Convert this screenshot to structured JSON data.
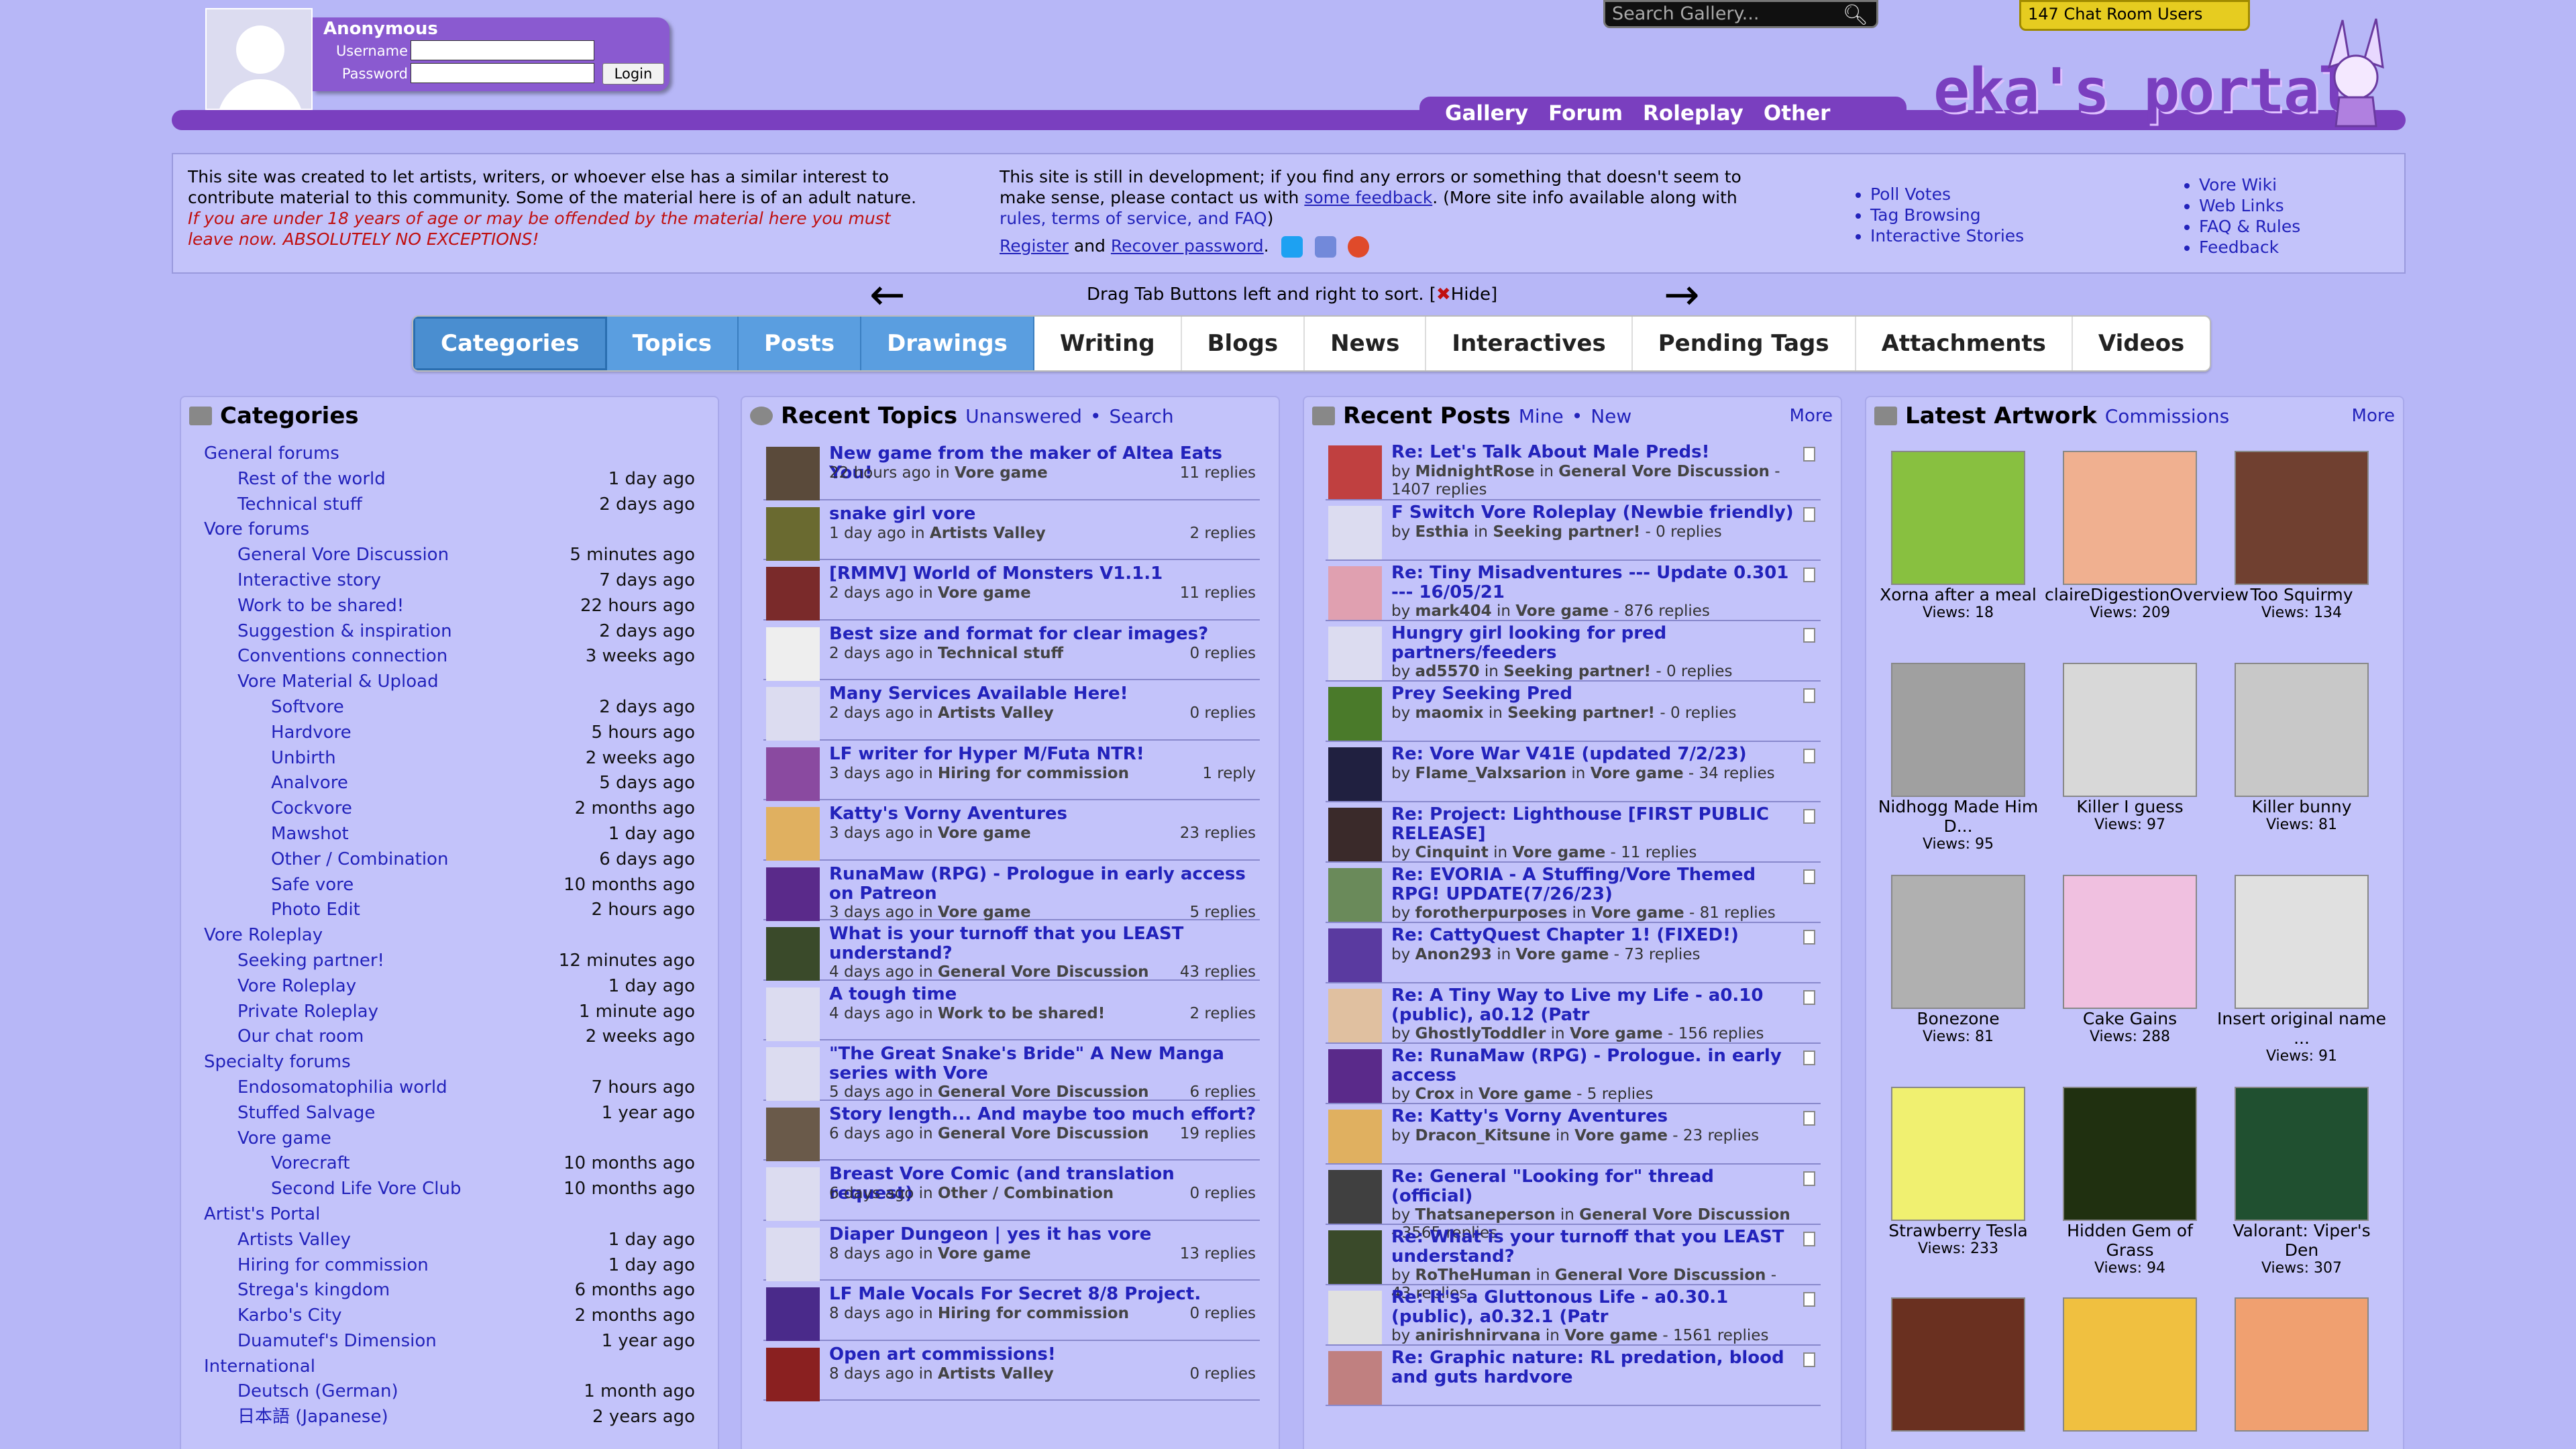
{
  "header": {
    "user": "Anonymous",
    "username_label": "Username",
    "password_label": "Password",
    "login_button": "Login",
    "search_placeholder": "Search Gallery...",
    "chat_users": "147 Chat Room Users",
    "logo_text": "eka's portal",
    "nav": [
      "Gallery",
      "Forum",
      "Roleplay",
      "Other"
    ]
  },
  "info": {
    "intro": "This site was created to let artists, writers, or whoever else has a similar interest to contribute material to this community. Some of the material here is of an adult nature.",
    "warning": "If you are under 18 years of age or may be offended by the material here you must leave now. ABSOLUTELY NO EXCEPTIONS!",
    "dev_text_1": "This site is still in development; if you find any errors or something that doesn't seem to make sense, please contact us with",
    "dev_link_feedback": "some feedback",
    "dev_text_2": ". (More site info available along with",
    "dev_link_rules": "rules, terms of service, and FAQ",
    "dev_text_3": ")",
    "register": "Register",
    "and": "and",
    "recover": "Recover password",
    "links_a": [
      "Poll Votes",
      "Tag Browsing",
      "Interactive Stories"
    ],
    "links_b": [
      "Vore Wiki",
      "Web Links",
      "FAQ & Rules",
      "Feedback"
    ]
  },
  "drag": {
    "text": "Drag Tab Buttons left and right to sort. [",
    "hide": "Hide]",
    "left_arrow": "←",
    "right_arrow": "→"
  },
  "tabs": [
    "Categories",
    "Topics",
    "Posts",
    "Drawings",
    "Writing",
    "Blogs",
    "News",
    "Interactives",
    "Pending Tags",
    "Attachments",
    "Videos"
  ],
  "categories": {
    "title": "Categories",
    "rows": [
      {
        "name": "General forums",
        "time": "",
        "indent": 0
      },
      {
        "name": "Rest of the world",
        "time": "1 day ago",
        "indent": 1
      },
      {
        "name": "Technical stuff",
        "time": "2 days ago",
        "indent": 1
      },
      {
        "name": "Vore forums",
        "time": "",
        "indent": 0
      },
      {
        "name": "General Vore Discussion",
        "time": "5 minutes ago",
        "indent": 1
      },
      {
        "name": "Interactive story",
        "time": "7 days ago",
        "indent": 1
      },
      {
        "name": "Work to be shared!",
        "time": "22 hours ago",
        "indent": 1
      },
      {
        "name": "Suggestion & inspiration",
        "time": "2 days ago",
        "indent": 1
      },
      {
        "name": "Conventions connection",
        "time": "3 weeks ago",
        "indent": 1
      },
      {
        "name": "Vore Material & Upload",
        "time": "",
        "indent": 1
      },
      {
        "name": "Softvore",
        "time": "2 days ago",
        "indent": 2
      },
      {
        "name": "Hardvore",
        "time": "5 hours ago",
        "indent": 2
      },
      {
        "name": "Unbirth",
        "time": "2 weeks ago",
        "indent": 2
      },
      {
        "name": "Analvore",
        "time": "5 days ago",
        "indent": 2
      },
      {
        "name": "Cockvore",
        "time": "2 months ago",
        "indent": 2
      },
      {
        "name": "Mawshot",
        "time": "1 day ago",
        "indent": 2
      },
      {
        "name": "Other / Combination",
        "time": "6 days ago",
        "indent": 2
      },
      {
        "name": "Safe vore",
        "time": "10 months ago",
        "indent": 2
      },
      {
        "name": "Photo Edit",
        "time": "2 hours ago",
        "indent": 2
      },
      {
        "name": "Vore Roleplay",
        "time": "",
        "indent": 0
      },
      {
        "name": "Seeking partner!",
        "time": "12 minutes ago",
        "indent": 1
      },
      {
        "name": "Vore Roleplay",
        "time": "1 day ago",
        "indent": 1
      },
      {
        "name": "Private Roleplay",
        "time": "1 minute ago",
        "indent": 1
      },
      {
        "name": "Our chat room",
        "time": "2 weeks ago",
        "indent": 1
      },
      {
        "name": "Specialty forums",
        "time": "",
        "indent": 0
      },
      {
        "name": "Endosomatophilia world",
        "time": "7 hours ago",
        "indent": 1
      },
      {
        "name": "Stuffed Salvage",
        "time": "1 year ago",
        "indent": 1
      },
      {
        "name": "Vore game",
        "time": "",
        "indent": 1
      },
      {
        "name": "Vorecraft",
        "time": "10 months ago",
        "indent": 2
      },
      {
        "name": "Second Life Vore Club",
        "time": "10 months ago",
        "indent": 2
      },
      {
        "name": "Artist's Portal",
        "time": "",
        "indent": 0
      },
      {
        "name": "Artists Valley",
        "time": "1 day ago",
        "indent": 1
      },
      {
        "name": "Hiring for commission",
        "time": "1 day ago",
        "indent": 1
      },
      {
        "name": "Strega's kingdom",
        "time": "6 months ago",
        "indent": 1
      },
      {
        "name": "Karbo's City",
        "time": "2 months ago",
        "indent": 1
      },
      {
        "name": "Duamutef's Dimension",
        "time": "1 year ago",
        "indent": 1
      },
      {
        "name": "International",
        "time": "",
        "indent": 0
      },
      {
        "name": "Deutsch (German)",
        "time": "1 month ago",
        "indent": 1
      },
      {
        "name": "日本語 (Japanese)",
        "time": "2 years ago",
        "indent": 1
      }
    ]
  },
  "topics": {
    "title": "Recent Topics",
    "unanswered": "Unanswered",
    "sep": "•",
    "search": "Search",
    "items": [
      {
        "title": "New game from the maker of Altea Eats You!",
        "time": "22 hours ago in",
        "cat": "Vore game",
        "replies": "11 replies",
        "color": "#5a4a3a"
      },
      {
        "title": "snake girl vore",
        "time": "1 day ago in",
        "cat": "Artists Valley",
        "replies": "2 replies",
        "color": "#6a6a30"
      },
      {
        "title": "[RMMV] World of Monsters V1.1.1",
        "time": "2 days ago in",
        "cat": "Vore game",
        "replies": "11 replies",
        "color": "#7a2a2a"
      },
      {
        "title": "Best size and format for clear images?",
        "time": "2 days ago in",
        "cat": "Technical stuff",
        "replies": "0 replies",
        "color": "#eeeeee"
      },
      {
        "title": "Many Services Available Here!",
        "time": "2 days ago in",
        "cat": "Artists Valley",
        "replies": "0 replies",
        "color": "#dcdcf0"
      },
      {
        "title": "LF writer for Hyper M/Futa NTR!",
        "time": "3 days ago in",
        "cat": "Hiring for commission",
        "replies": "1 reply",
        "color": "#8a4aa0"
      },
      {
        "title": "Katty's Vorny Aventures",
        "time": "3 days ago in",
        "cat": "Vore game",
        "replies": "23 replies",
        "color": "#e0b060"
      },
      {
        "title": "RunaMaw (RPG) - Prologue in early access on Patreon",
        "time": "3 days ago in",
        "cat": "Vore game",
        "replies": "5 replies",
        "color": "#5a2a8a"
      },
      {
        "title": "What is your turnoff that you LEAST understand?",
        "time": "4 days ago in",
        "cat": "General Vore Discussion",
        "replies": "43 replies",
        "color": "#3a4a2a"
      },
      {
        "title": "A tough time",
        "time": "4 days ago in",
        "cat": "Work to be shared!",
        "replies": "2 replies",
        "color": "#dcdcf0"
      },
      {
        "title": "\"The Great Snake's Bride\" A New Manga series with Vore",
        "time": "5 days ago in",
        "cat": "General Vore Discussion",
        "replies": "6 replies",
        "color": "#dcdcf0"
      },
      {
        "title": "Story length... And maybe too much effort?",
        "time": "6 days ago in",
        "cat": "General Vore Discussion",
        "replies": "19 replies",
        "color": "#6a5a4a"
      },
      {
        "title": "Breast Vore Comic (and translation request)",
        "time": "6 days ago in",
        "cat": "Other / Combination",
        "replies": "0 replies",
        "color": "#dcdcf0"
      },
      {
        "title": "Diaper Dungeon | yes it has vore",
        "time": "8 days ago in",
        "cat": "Vore game",
        "replies": "13 replies",
        "color": "#dcdcf0"
      },
      {
        "title": "LF Male Vocals For Secret 8/8 Project.",
        "time": "8 days ago in",
        "cat": "Hiring for commission",
        "replies": "0 replies",
        "color": "#4a2a8a"
      },
      {
        "title": "Open art commissions!",
        "time": "8 days ago in",
        "cat": "Artists Valley",
        "replies": "0 replies",
        "color": "#8a2020"
      }
    ]
  },
  "posts": {
    "title": "Recent Posts",
    "mine": "Mine",
    "sep": "•",
    "new": "New",
    "more": "More",
    "items": [
      {
        "title": "Re: Let's Talk About Male Preds!",
        "by": "MidnightRose",
        "cat": "General Vore Discussion",
        "replies": "1407 replies",
        "color": "#c04040"
      },
      {
        "title": "F Switch Vore Roleplay (Newbie friendly)",
        "by": "Esthia",
        "cat": "Seeking partner!",
        "replies": "0 replies",
        "color": "#dcdcf0"
      },
      {
        "title": "Re: Tiny Misadventures --- Update 0.301 --- 16/05/21",
        "by": "mark404",
        "cat": "Vore game",
        "replies": "876 replies",
        "color": "#e0a0b0"
      },
      {
        "title": "Hungry girl looking for pred partners/feeders",
        "by": "ad5570",
        "cat": "Seeking partner!",
        "replies": "0 replies",
        "color": "#dcdcf0"
      },
      {
        "title": "Prey Seeking Pred",
        "by": "maomix",
        "cat": "Seeking partner!",
        "replies": "0 replies",
        "color": "#4a7a2a"
      },
      {
        "title": "Re: Vore War V41E (updated 7/2/23)",
        "by": "Flame_Valxsarion",
        "cat": "Vore game",
        "replies": "34 replies",
        "color": "#202040"
      },
      {
        "title": "Re: Project: Lighthouse [FIRST PUBLIC RELEASE]",
        "by": "Cinquint",
        "cat": "Vore game",
        "replies": "11 replies",
        "color": "#3a2a2a"
      },
      {
        "title": "Re: EVORIA - A Stuffing/Vore Themed RPG! UPDATE(7/26/23)",
        "by": "forotherpurposes",
        "cat": "Vore game",
        "replies": "81 replies",
        "color": "#6a8a5a"
      },
      {
        "title": "Re: CattyQuest Chapter 1! (FIXED!)",
        "by": "Anon293",
        "cat": "Vore game",
        "replies": "73 replies",
        "color": "#5a3aa0"
      },
      {
        "title": "Re: A Tiny Way to Live my Life - a0.10 (public), a0.12 (Patr",
        "by": "GhostlyToddler",
        "cat": "Vore game",
        "replies": "156 replies",
        "color": "#e0c0a0"
      },
      {
        "title": "Re: RunaMaw (RPG) - Prologue. in early access",
        "by": "Crox",
        "cat": "Vore game",
        "replies": "5 replies",
        "color": "#5a2a8a"
      },
      {
        "title": "Re: Katty's Vorny Aventures",
        "by": "Dracon_Kitsune",
        "cat": "Vore game",
        "replies": "23 replies",
        "color": "#e0b060"
      },
      {
        "title": "Re: General \"Looking for\" thread (official)",
        "by": "Thatsaneperson",
        "cat": "General Vore Discussion",
        "replies": "3565 replies",
        "color": "#404040"
      },
      {
        "title": "Re: What is your turnoff that you LEAST understand?",
        "by": "RoTheHuman",
        "cat": "General Vore Discussion",
        "replies": "43 replies",
        "color": "#3a4a2a"
      },
      {
        "title": "Re: It's a Gluttonous Life - a0.30.1 (public), a0.32.1 (Patr",
        "by": "anirishnirvana",
        "cat": "Vore game",
        "replies": "1561 replies",
        "color": "#e0e0e0"
      },
      {
        "title": "Re: Graphic nature: RL predation, blood and guts hardvore",
        "by": "",
        "cat": "",
        "replies": "",
        "color": "#c08080"
      }
    ],
    "by_label": "by",
    "in_label": "in"
  },
  "artwork": {
    "title": "Latest Artwork",
    "commissions": "Commissions",
    "more": "More",
    "items": [
      {
        "name": "Xorna after a meal",
        "views": "Views: 18",
        "color": "#88c040"
      },
      {
        "name": "claireDigestionOverview",
        "views": "Views: 209",
        "color": "#f0b090"
      },
      {
        "name": "Too Squirmy",
        "views": "Views: 134",
        "color": "#704030"
      },
      {
        "name": "Nidhogg Made Him D...",
        "views": "Views: 95",
        "color": "#a0a0a0"
      },
      {
        "name": "Killer I guess",
        "views": "Views: 97",
        "color": "#d8d8d8"
      },
      {
        "name": "Killer bunny",
        "views": "Views: 81",
        "color": "#c8c8c8"
      },
      {
        "name": "Bonezone",
        "views": "Views: 81",
        "color": "#b0b0b0"
      },
      {
        "name": "Cake Gains",
        "views": "Views: 288",
        "color": "#f0c0e0"
      },
      {
        "name": "Insert original name ...",
        "views": "Views: 91",
        "color": "#e0e0e0"
      },
      {
        "name": "Strawberry Tesla",
        "views": "Views: 233",
        "color": "#f0f070"
      },
      {
        "name": "Hidden Gem of Grass",
        "views": "Views: 94",
        "color": "#203010"
      },
      {
        "name": "Valorant: Viper's Den",
        "views": "Views: 307",
        "color": "#205030"
      },
      {
        "name": "",
        "views": "",
        "color": "#6a3020"
      },
      {
        "name": "",
        "views": "",
        "color": "#f0c040"
      },
      {
        "name": "",
        "views": "",
        "color": "#f0a070"
      }
    ]
  }
}
